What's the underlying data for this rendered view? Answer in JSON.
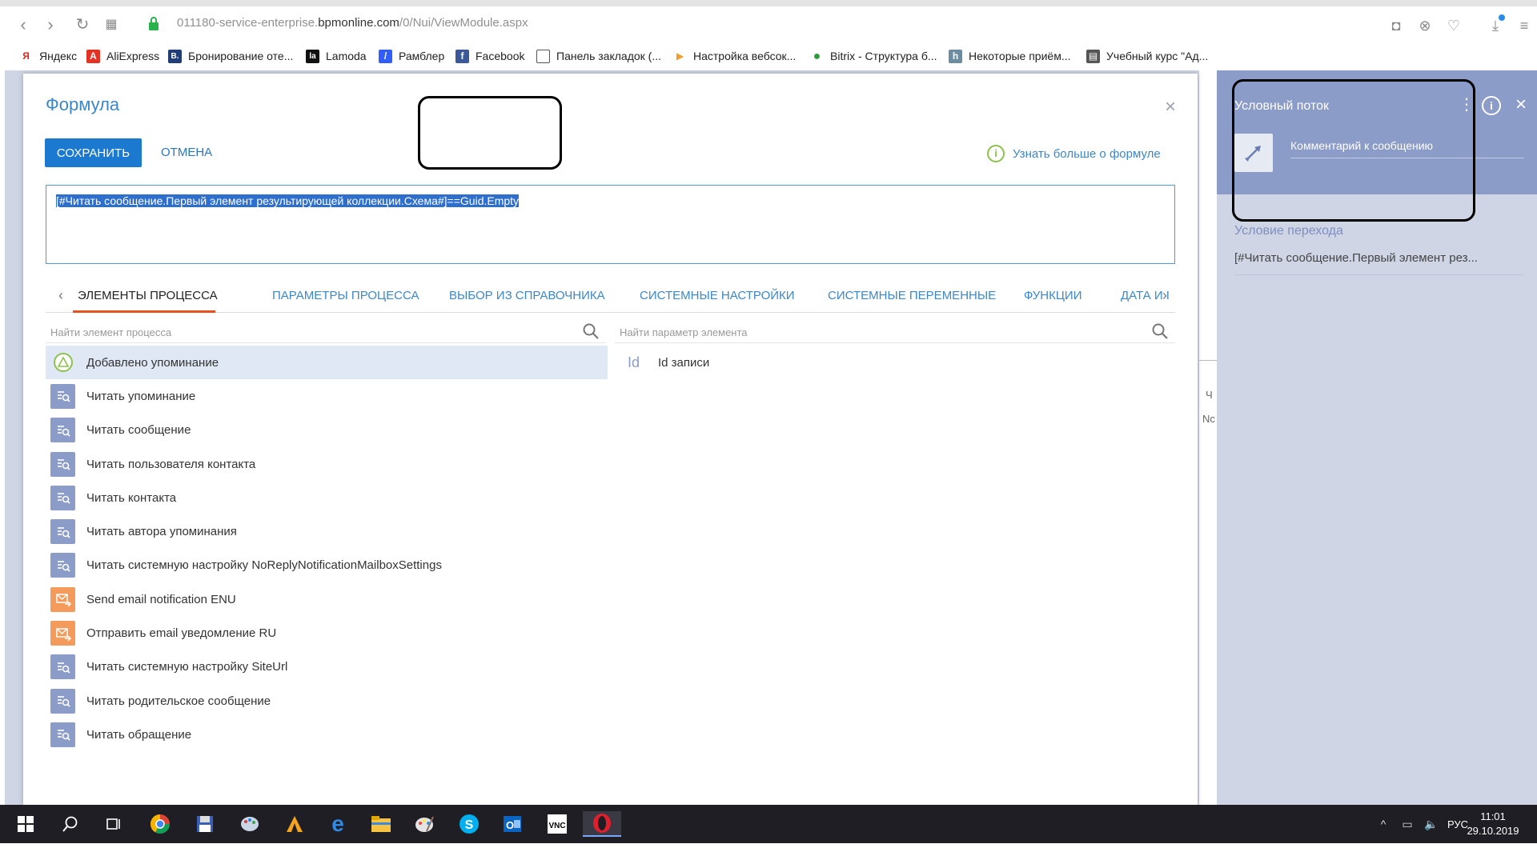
{
  "browser": {
    "url_prefix": "011180-service-enterprise.",
    "url_host": "bpmonline.com",
    "url_path": "/0/Nui/ViewModule.aspx"
  },
  "bookmarks": [
    {
      "label": "Яндекс",
      "icon": "yandex-icon",
      "color": "#e52620",
      "glyph": "Я"
    },
    {
      "label": "AliExpress",
      "icon": "aliexpress-icon",
      "color": "#e43225",
      "glyph": "A"
    },
    {
      "label": "Бронирование оте...",
      "icon": "booking-icon",
      "color": "#213d77",
      "glyph": "B."
    },
    {
      "label": "Lamoda",
      "icon": "lamoda-icon",
      "color": "#111111",
      "glyph": "la"
    },
    {
      "label": "Рамблер",
      "icon": "rambler-icon",
      "color": "#315efb",
      "glyph": "/"
    },
    {
      "label": "Facebook",
      "icon": "facebook-icon",
      "color": "#3b5998",
      "glyph": "f"
    },
    {
      "label": "Панель закладок (...",
      "icon": "folder-icon",
      "color": "#ffffff",
      "glyph": "▭"
    },
    {
      "label": "Настройка вебсок...",
      "icon": "arrow-bookmark-icon",
      "color": "#f39c2c",
      "glyph": "▶"
    },
    {
      "label": "Bitrix - Структура б...",
      "icon": "bitrix-icon",
      "color": "#2e9b3c",
      "glyph": "●"
    },
    {
      "label": "Некоторые приём...",
      "icon": "habr-icon",
      "color": "#6d8ca2",
      "glyph": "h"
    },
    {
      "label": "Учебный курс \"Ад...",
      "icon": "document-icon",
      "color": "#555555",
      "glyph": "▤"
    }
  ],
  "modal": {
    "title": "Формула",
    "save_label": "СОХРАНИТЬ",
    "cancel_label": "ОТМЕНА",
    "learn_more": "Узнать больше о формуле",
    "formula": "[#Читать сообщение.Первый элемент результирующей коллекции.Схема#]==Guid.Empty",
    "tabs": [
      {
        "label": "ЭЛЕМЕНТЫ ПРОЦЕССА",
        "active": true
      },
      {
        "label": "ПАРАМЕТРЫ ПРОЦЕССА"
      },
      {
        "label": "ВЫБОР ИЗ СПРАВОЧНИКА"
      },
      {
        "label": "СИСТЕМНЫЕ НАСТРОЙКИ"
      },
      {
        "label": "СИСТЕМНЫЕ ПЕРЕМЕННЫЕ"
      },
      {
        "label": "ФУНКЦИИ"
      },
      {
        "label": "ДАТА И I"
      }
    ],
    "search_elements_placeholder": "Найти элемент процесса",
    "search_params_placeholder": "Найти параметр элемента",
    "elements": [
      {
        "label": "Добавлено упоминание",
        "type": "start",
        "selected": true
      },
      {
        "label": "Читать упоминание",
        "type": "read"
      },
      {
        "label": "Читать сообщение",
        "type": "read"
      },
      {
        "label": "Читать пользователя контакта",
        "type": "read"
      },
      {
        "label": "Читать контакта",
        "type": "read"
      },
      {
        "label": "Читать автора упоминания",
        "type": "read"
      },
      {
        "label": "Читать системную настройку NoReplyNotificationMailboxSettings",
        "type": "read"
      },
      {
        "label": "Send email notification ENU",
        "type": "email"
      },
      {
        "label": "Отправить email уведомление RU",
        "type": "email"
      },
      {
        "label": "Читать системную настройку SiteUrl",
        "type": "read"
      },
      {
        "label": "Читать родительское сообщение",
        "type": "read"
      },
      {
        "label": "Читать обращение",
        "type": "read"
      }
    ],
    "params": [
      {
        "id_glyph": "Id",
        "label": "Id записи"
      }
    ]
  },
  "side_panel": {
    "title": "Условный поток",
    "comment_placeholder": "Комментарий к сообщению",
    "condition_label": "Условие перехода",
    "condition_value": "[#Читать сообщение.Первый элемент рез..."
  },
  "background_strip": {
    "t1": "Ч",
    "t2": "Nc"
  },
  "taskbar": {
    "lang": "РУС",
    "time": "11:01",
    "date": "29.10.2019"
  },
  "colors": {
    "accent_blue": "#1b79d0",
    "link_blue": "#3c87c7",
    "tab_underline": "#e8501f",
    "side_header": "#8b9cc9",
    "read_icon": "#8b9cc9",
    "email_icon": "#f49a5a",
    "start_icon": "#8bc34a"
  }
}
